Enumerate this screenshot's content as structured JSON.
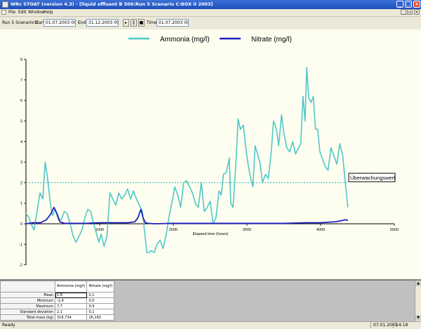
{
  "window": {
    "title": "WRc STOAT (version 4.3) - [liquid effluent B 500:Run 5 Scenario C:BOX II 2003]",
    "buttons": {
      "minimize": "_",
      "maximize": "□",
      "close": "×"
    }
  },
  "menu": {
    "items": [
      {
        "label": "File"
      },
      {
        "label": "Edit"
      },
      {
        "label": "Window"
      },
      {
        "label": "Help"
      }
    ],
    "mdi_buttons": {
      "minimize": "_",
      "restore": "▫",
      "close": "×"
    }
  },
  "toolbar": {
    "run_value": "Run 5 Scenario C",
    "start_label": "Start",
    "start_value": "01.07.2003 00:00",
    "end_label": "End",
    "end_value": "31.12.2003 00:00",
    "play_icon": "▸",
    "pause_icon": "‖",
    "stop_icon": "■",
    "time_label": "Time",
    "time_value": "01.07.2003 00:00"
  },
  "chart_data": {
    "type": "line",
    "xlabel": "Elapsed time (hours)",
    "ylabel": "",
    "xlim": [
      0,
      5000
    ],
    "ylim": [
      -2,
      8
    ],
    "x_ticks": [
      "1000",
      "2000",
      "3000",
      "4000",
      "5000"
    ],
    "y_ticks": [
      "-2",
      "-1",
      "0",
      "1",
      "2",
      "3",
      "4",
      "5",
      "6",
      "7",
      "8"
    ],
    "grid": false,
    "legend_position": "top",
    "series": [
      {
        "name": "Ammonia (mg/l)",
        "color": "#4fc8c8",
        "x": [
          0,
          40,
          80,
          110,
          150,
          190,
          230,
          260,
          290,
          330,
          360,
          400,
          440,
          480,
          520,
          560,
          600,
          640,
          680,
          720,
          760,
          800,
          840,
          880,
          910,
          950,
          990,
          1020,
          1060,
          1100,
          1140,
          1180,
          1220,
          1260,
          1300,
          1340,
          1380,
          1420,
          1460,
          1500,
          1540,
          1580,
          1620,
          1640,
          1670,
          1700,
          1740,
          1780,
          1820,
          1860,
          1900,
          1940,
          1980,
          2020,
          2060,
          2100,
          2140,
          2180,
          2220,
          2260,
          2300,
          2340,
          2380,
          2420,
          2460,
          2500,
          2540,
          2580,
          2620,
          2650,
          2680,
          2720,
          2760,
          2780,
          2810,
          2850,
          2880,
          2910,
          2950,
          2980,
          3010,
          3050,
          3080,
          3110,
          3150,
          3180,
          3210,
          3250,
          3290,
          3330,
          3360,
          3400,
          3430,
          3470,
          3500,
          3540,
          3580,
          3620,
          3660,
          3700,
          3730,
          3760,
          3790,
          3810,
          3840,
          3870,
          3900,
          3930,
          3960,
          3990,
          4020,
          4060,
          4100,
          4140,
          4180,
          4220,
          4260,
          4300,
          4340,
          4370
        ],
        "values": [
          0.5,
          0.3,
          -0.1,
          -0.3,
          0.6,
          1.5,
          1.2,
          3.0,
          2.3,
          1.0,
          0.4,
          0.7,
          0.2,
          0.2,
          0.6,
          0.5,
          0.0,
          -0.6,
          -0.9,
          -0.6,
          -0.3,
          0.3,
          0.7,
          0.6,
          0.1,
          -0.4,
          -0.9,
          -0.5,
          -1.1,
          -0.6,
          1.5,
          1.2,
          0.9,
          1.5,
          1.2,
          1.4,
          1.7,
          1.2,
          1.6,
          1.2,
          0.9,
          0.6,
          -0.7,
          -1.4,
          -1.4,
          -1.3,
          -1.4,
          -1.0,
          -0.8,
          -1.2,
          -0.6,
          0.3,
          1.0,
          1.8,
          1.4,
          0.8,
          2.0,
          2.1,
          1.8,
          1.5,
          1.0,
          0.8,
          2.0,
          0.6,
          0.8,
          1.1,
          0.0,
          0.3,
          1.6,
          1.4,
          2.4,
          2.5,
          3.2,
          1.0,
          0.8,
          3.0,
          5.1,
          4.6,
          4.8,
          3.8,
          3.0,
          2.2,
          1.8,
          3.8,
          3.3,
          2.9,
          2.0,
          2.4,
          2.2,
          3.5,
          5.0,
          4.6,
          3.8,
          5.3,
          4.4,
          3.7,
          3.5,
          4.0,
          3.4,
          3.7,
          3.9,
          6.2,
          5.0,
          7.6,
          6.1,
          5.9,
          6.2,
          4.6,
          4.6,
          3.5,
          3.2,
          2.8,
          2.6,
          3.7,
          3.3,
          2.9,
          3.9,
          3.3,
          1.8,
          0.8
        ]
      },
      {
        "name": "Nitrate (mg/l)",
        "color": "#2020c0",
        "x": [
          0,
          100,
          200,
          280,
          340,
          380,
          420,
          460,
          520,
          600,
          800,
          1000,
          1200,
          1380,
          1480,
          1520,
          1560,
          1590,
          1620,
          1660,
          1740,
          2000,
          2500,
          3000,
          3500,
          3800,
          4000,
          4200,
          4280,
          4340,
          4370
        ],
        "values": [
          0.0,
          0.05,
          0.05,
          0.2,
          0.5,
          0.8,
          0.5,
          0.1,
          0.02,
          0.02,
          0.02,
          0.05,
          0.05,
          0.05,
          0.1,
          0.3,
          0.7,
          0.3,
          0.05,
          0.02,
          0.0,
          0.02,
          0.02,
          0.02,
          0.02,
          0.05,
          0.05,
          0.1,
          0.15,
          0.2,
          0.15
        ]
      }
    ],
    "threshold": {
      "value": 2.0,
      "label": "Überwachungswert",
      "color": "#4fc8c8"
    }
  },
  "stats_table": {
    "columns": [
      "Ammonia (mg/l)",
      "Nitrate (mg/l)"
    ],
    "rows": [
      {
        "label": "Mean",
        "values": [
          "1,8",
          "0,1"
        ]
      },
      {
        "label": "Minimum",
        "values": [
          "-1,4",
          "0,0"
        ]
      },
      {
        "label": "Maximum",
        "values": [
          "7,7",
          "0,9"
        ]
      },
      {
        "label": "Standard deviation",
        "values": [
          "2,1",
          "0,1"
        ]
      },
      {
        "label": "Total mass (kg)",
        "values": [
          "318,734",
          "16,183"
        ]
      }
    ]
  },
  "statusbar": {
    "status": "Ready",
    "date": "07.01.2005",
    "time": "14:18"
  }
}
